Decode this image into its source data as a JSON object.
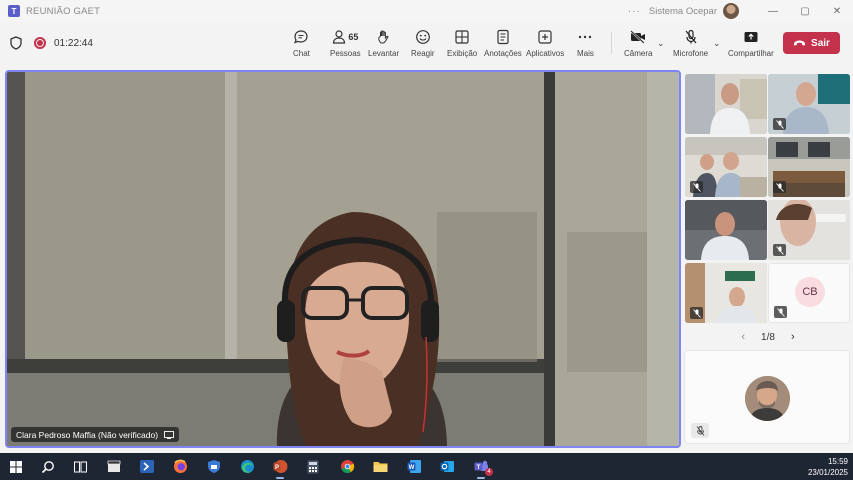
{
  "window": {
    "title": "REUNIÃO GAET",
    "more": "···",
    "organization": "Sistema Ocepar",
    "controls": {
      "minimize": "—",
      "maximize": "▢",
      "close": "✕"
    }
  },
  "meeting": {
    "elapsed": "01:22:44",
    "participant_count": "65"
  },
  "toolbar": {
    "chat": "Chat",
    "people": "Pessoas",
    "raise": "Levantar",
    "react": "Reagir",
    "view": "Exibição",
    "notes": "Anotações",
    "apps": "Aplicativos",
    "more": "Mais",
    "camera": "Câmera",
    "mic": "Microfone",
    "share": "Compartilhar",
    "leave": "Sair"
  },
  "main_video": {
    "speaker_name": "Clara Pedroso Maffia (Não verificado)"
  },
  "grid": {
    "cb_initials": "CB",
    "page": "1/8"
  },
  "taskbar": {
    "time": "15:59",
    "date": "23/01/2025",
    "teams_badge": "4"
  },
  "colors": {
    "accent": "#5b5fc7",
    "leave": "#c4314b",
    "speaker_border": "#7f85f5",
    "taskbar": "#1f2633"
  }
}
